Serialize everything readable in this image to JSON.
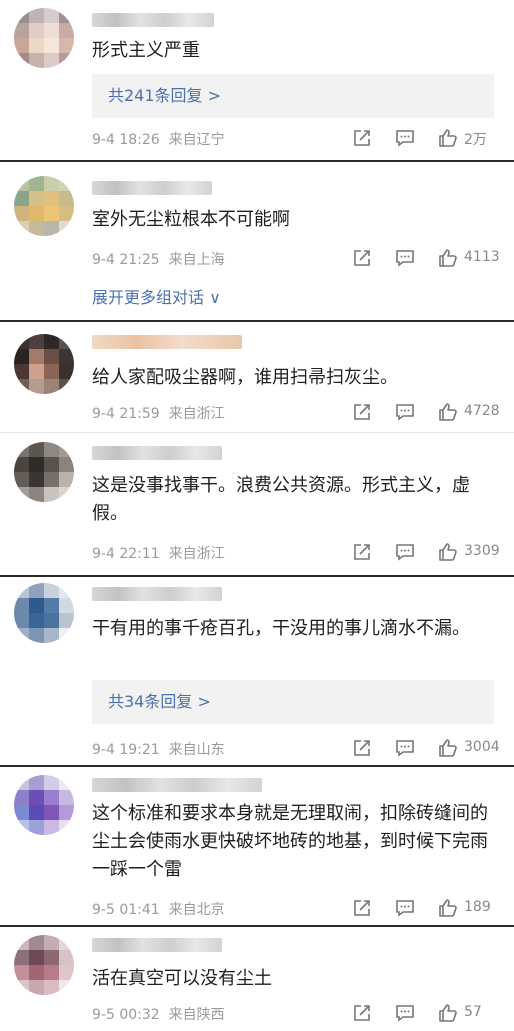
{
  "colors": {
    "link": "#4a72ad",
    "meta": "#9a9a9a",
    "text": "#1f1f1f",
    "reply_bg": "#f2f2f2"
  },
  "comments": [
    {
      "text": "形式主义严重",
      "reply_label": "共241条回复 >",
      "date": "9-4 18:26",
      "location": "来自辽宁",
      "likes": "2万"
    },
    {
      "text": "室外无尘粒根本不可能啊",
      "date": "9-4 21:25",
      "location": "来自上海",
      "likes": "4113",
      "more_label": "展开更多组对话 ∨"
    },
    {
      "text": "给人家配吸尘器啊，谁用扫帚扫灰尘。",
      "date": "9-4 21:59",
      "location": "来自浙江",
      "likes": "4728"
    },
    {
      "text": "这是没事找事干。浪费公共资源。形式主义，虚假。",
      "date": "9-4 22:11",
      "location": "来自浙江",
      "likes": "3309"
    },
    {
      "text": "干有用的事千疮百孔，干没用的事儿滴水不漏。",
      "reply_label": "共34条回复 >",
      "date": "9-4 19:21",
      "location": "来自山东",
      "likes": "3004"
    },
    {
      "text": "这个标准和要求本身就是无理取闹，扣除砖缝间的尘土会使雨水更快破坏地砖的地基，到时候下完雨一踩一个雷",
      "date": "9-5 01:41",
      "location": "来自北京",
      "likes": "189"
    },
    {
      "text": "活在真空可以没有尘土",
      "date": "9-5 00:32",
      "location": "来自陕西",
      "likes": "57"
    }
  ],
  "icons": {
    "forward": "forward-icon",
    "comment": "comment-icon",
    "like": "thumbs-up-icon"
  }
}
